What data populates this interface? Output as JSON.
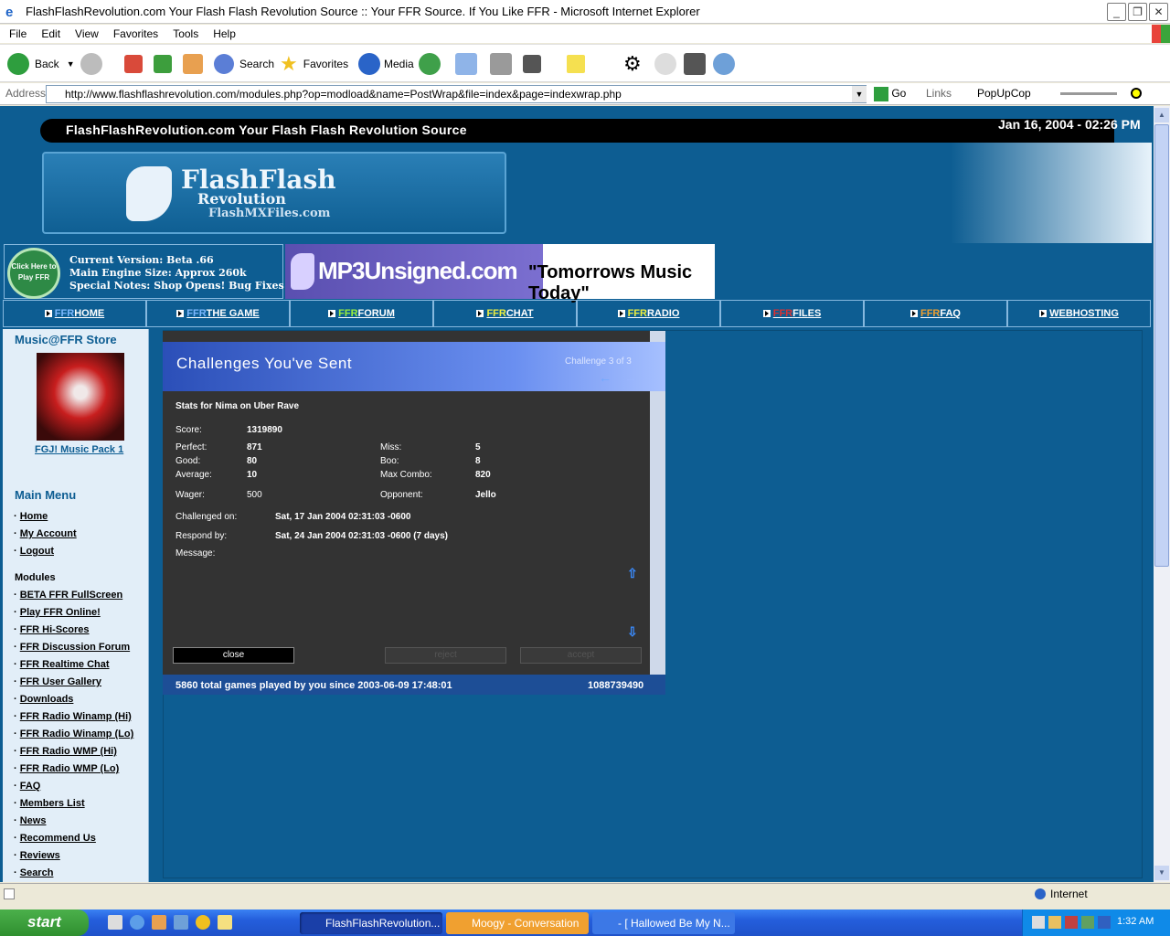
{
  "window": {
    "title": "FlashFlashRevolution.com Your Flash Flash Revolution Source :: Your FFR Source. If You Like FFR - Microsoft Internet Explorer"
  },
  "menu": [
    "File",
    "Edit",
    "View",
    "Favorites",
    "Tools",
    "Help"
  ],
  "toolbar": {
    "back": "Back",
    "search": "Search",
    "favorites": "Favorites",
    "media": "Media"
  },
  "address": {
    "label": "Address",
    "url": "http://www.flashflashrevolution.com/modules.php?op=modload&name=PostWrap&file=index&page=indexwrap.php",
    "go": "Go",
    "links": "Links",
    "popup": "PopUpCop"
  },
  "site": {
    "header": "FlashFlashRevolution.com Your Flash Flash Revolution Source",
    "date": "Jan 16, 2004 - 02:26 PM",
    "logo_line1": "FlashFlash",
    "logo_line2": "Revolution",
    "logo_line3": "FlashMXFiles.com",
    "play_button": "Click Here to Play FFR",
    "version": "Current Version: Beta .66",
    "engine": "Main Engine Size: Approx 260k",
    "notes": "Special Notes: Shop Opens! Bug Fixes",
    "banner_brand": "MP3Unsigned.com",
    "banner_tagline": "\"Tomorrows Music Today\""
  },
  "nav": [
    {
      "p": "FFR",
      "t": "HOME"
    },
    {
      "p": "FFR",
      "t": "THE GAME"
    },
    {
      "p": "FFR",
      "t": "FORUM"
    },
    {
      "p": "FFR",
      "t": "CHAT"
    },
    {
      "p": "FFR",
      "t": "RADIO"
    },
    {
      "p": "FFR",
      "t": "FILES"
    },
    {
      "p": "FFR",
      "t": "FAQ"
    },
    {
      "p": "",
      "t": "WEBHOSTING"
    }
  ],
  "sidebar": {
    "store_title": "Music@FFR Store",
    "store_item": "FGJ! Music Pack 1",
    "main_menu": "Main Menu",
    "main_items": [
      "Home",
      "My Account",
      "Logout"
    ],
    "modules_title": "Modules",
    "modules": [
      "BETA FFR FullScreen",
      "Play FFR Online!",
      "FFR Hi-Scores",
      "FFR Discussion Forum",
      "FFR Realtime Chat",
      "FFR User Gallery",
      "Downloads",
      "FFR Radio Winamp (Hi)",
      "FFR Radio Winamp (Lo)",
      "FFR Radio WMP (Hi)",
      "FFR Radio WMP (Lo)",
      "FAQ",
      "Members List",
      "News",
      "Recommend Us",
      "Reviews",
      "Search"
    ]
  },
  "dialog": {
    "title": "Challenges You've Sent",
    "counter": "Challenge 3 of 3",
    "stats_for": "Stats for Nima on Uber Rave",
    "score_l": "Score:",
    "score": "1319890",
    "perfect_l": "Perfect:",
    "perfect": "871",
    "good_l": "Good:",
    "good": "80",
    "average_l": "Average:",
    "average": "10",
    "miss_l": "Miss:",
    "miss": "5",
    "boo_l": "Boo:",
    "boo": "8",
    "maxcombo_l": "Max Combo:",
    "maxcombo": "820",
    "wager_l": "Wager:",
    "wager": "500",
    "opponent_l": "Opponent:",
    "opponent": "Jello",
    "challenged_l": "Challenged on:",
    "challenged": "Sat, 17 Jan 2004 02:31:03 -0600",
    "respond_l": "Respond by:",
    "respond": "Sat, 24 Jan 2004 02:31:03 -0600 (7 days)",
    "message_l": "Message:",
    "close": "close",
    "reject": "reject",
    "accept": "accept",
    "footer_left": "5860 total games played by you since 2003-06-09 17:48:01",
    "footer_right": "1088739490"
  },
  "status": {
    "zone": "Internet"
  },
  "taskbar": {
    "start": "start",
    "tasks": [
      "FlashFlashRevolution...",
      "Moogy - Conversation",
      "- [ Hallowed Be My N..."
    ],
    "clock": "1:32 AM"
  }
}
